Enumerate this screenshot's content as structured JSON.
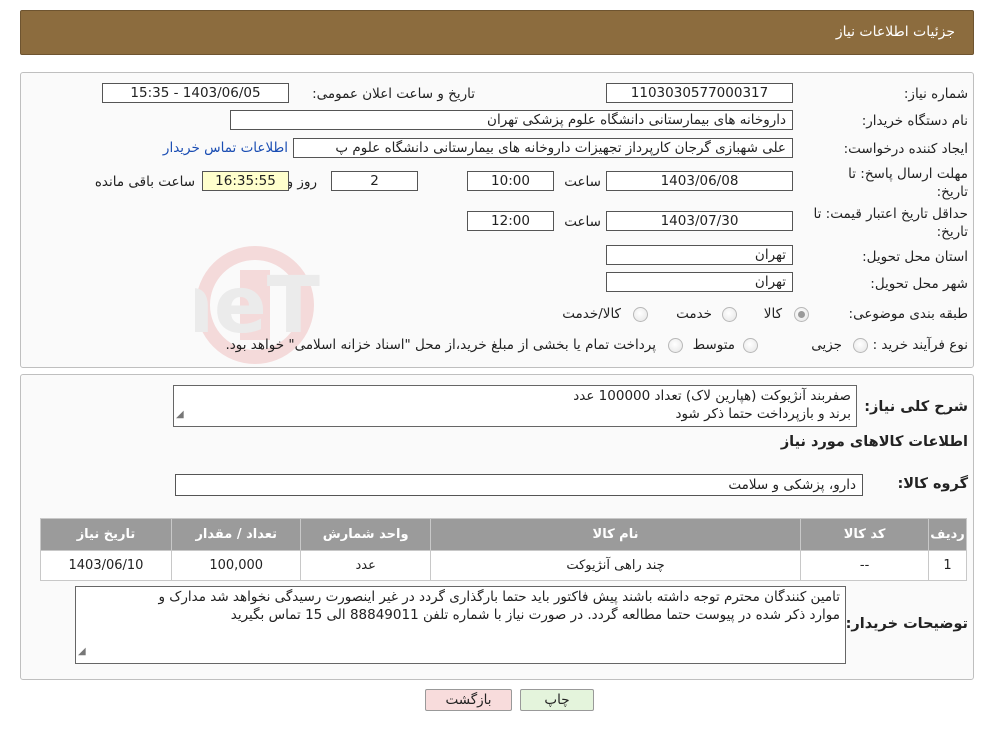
{
  "header": {
    "title": "جزئيات اطلاعات نياز"
  },
  "form": {
    "need_number_label": "شماره نیاز:",
    "need_number": "1103030577000317",
    "announce_label": "تاریخ و ساعت اعلان عمومی:",
    "announce_value": "1403/06/05 - 15:35",
    "buyer_org_label": "نام دستگاه خریدار:",
    "buyer_org": "داروخانه های بیمارستانی دانشگاه علوم پزشکی تهران",
    "creator_label": "ایجاد کننده درخواست:",
    "creator": "علی شهبازی گرجان کارپرداز تجهیزات داروخانه های بیمارستانی دانشگاه علوم پ",
    "contact_link": "اطلاعات تماس خریدار",
    "deadline_label_1": "مهلت ارسال پاسخ: تا",
    "deadline_label_2": "تاریخ:",
    "deadline_date": "1403/06/08",
    "time_label": "ساعت",
    "deadline_time": "10:00",
    "days_value": "2",
    "days_label": "روز و",
    "remaining_time": "16:35:55",
    "remaining_label": "ساعت باقی مانده",
    "validity_label_1": "حداقل تاریخ اعتبار قیمت: تا",
    "validity_label_2": "تاریخ:",
    "validity_date": "1403/07/30",
    "validity_time": "12:00",
    "province_label": "استان محل تحویل:",
    "province": "تهران",
    "city_label": "شهر محل تحویل:",
    "city": "تهران",
    "category_label": "طبقه بندی موضوعی:",
    "category_options": [
      "کالا",
      "خدمت",
      "کالا/خدمت"
    ],
    "process_label": "نوع فرآیند خرید :",
    "process_options": [
      "جزیی",
      "متوسط"
    ],
    "process_note": "پرداخت تمام یا بخشی از مبلغ خرید،از محل \"اسناد خزانه اسلامی\" خواهد بود."
  },
  "details": {
    "summary_label": "شرح کلی نیاز:",
    "summary_line1": "صفربند آنژیوکت (هپارین لاک) تعداد 100000 عدد",
    "summary_line2": "برند و بازپرداخت حتما ذکر شود",
    "goods_info_title": "اطلاعات کالاهای مورد نیاز",
    "goods_group_label": "گروه کالا:",
    "goods_group": "دارو، پزشکی و سلامت"
  },
  "table": {
    "headers": [
      "ردیف",
      "کد کالا",
      "نام کالا",
      "واحد شمارش",
      "تعداد / مقدار",
      "تاریخ نیاز"
    ],
    "rows": [
      [
        "1",
        "--",
        "چند راهی آنژیوکت",
        "عدد",
        "100,000",
        "1403/06/10"
      ]
    ]
  },
  "notes": {
    "label": "توضیحات خریدار:",
    "line1": "تامین کنندگان محترم توجه داشته باشند پیش فاکتور باید حتما بارگذاری گردد در غیر اینصورت رسیدگی نخواهد شد مدارک و",
    "line2": "موارد ذکر شده در پیوست حتما مطالعه گردد. در صورت نیاز با شماره تلفن 88849011 الی 15 تماس بگیرید"
  },
  "buttons": {
    "print": "چاپ",
    "back": "بازگشت"
  },
  "watermark": {
    "text": "AriaTender.neT"
  },
  "colors": {
    "header": "#8c6c3e",
    "highlight": "#ffffcc",
    "link": "#1a4db3",
    "back_btn": "#f8dcdc",
    "print_btn": "#e4f4dc"
  }
}
